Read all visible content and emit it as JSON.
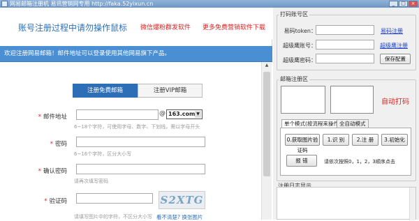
{
  "window": {
    "title": "网易邮箱注册机 易讯营销网专用 http://faka.52yixun.cn",
    "buttons": [
      "_",
      "□",
      "×"
    ]
  },
  "brand": {
    "title": "账号注册过程中请勿操作鼠标",
    "link1": "微信爆粉群发软件",
    "link2": "更多免费营销软件下载"
  },
  "welcome": "欢迎注册网易邮箱！邮件地址可以登录使用其他网易旗下产品。",
  "form": {
    "tab_free": "注册免费邮箱",
    "tab_vip": "注册VIP邮箱",
    "email_label": "邮件地址",
    "email_hint": "6~18个字符，可使用字母、数字、下划线，需以字母开头",
    "at": "@",
    "domain": "163.com",
    "password_label": "密码",
    "password_hint": "6~16个字符，区分大小写",
    "confirm_label": "确认密码",
    "confirm_hint": "请再次填写密码",
    "captcha_label": "验证码",
    "captcha_hint": "请填写图片中的字符，不区分大小写",
    "captcha_text": "S2XTG",
    "captcha_unclear": "看不清楚?",
    "captcha_switch": "换张图片",
    "star": "*"
  },
  "coder": {
    "group_title": "打码账号区",
    "token_label": "易码token：",
    "token_link": "易码注册",
    "super_user_label": "超级鹰账号：",
    "super_link": "超级鹰注册",
    "super_pass_label": "超级鹰密码：",
    "save_button": "保存配置"
  },
  "reg": {
    "group_title": "邮箱注册区",
    "auto_code": "自动打码",
    "tab_single": "单个模式(按流程来操作)",
    "tab_auto": "全自动模式",
    "btn_get_code": "0.获取图片验证码",
    "btn_recognize": "1.识 别",
    "btn_register": "2.注 册",
    "btn_init": "3.初始化",
    "btn_report": "报 错",
    "step_text": "请依次按照0，1，2，3顺序点击"
  },
  "log": {
    "group_title": "注册日志显示"
  }
}
